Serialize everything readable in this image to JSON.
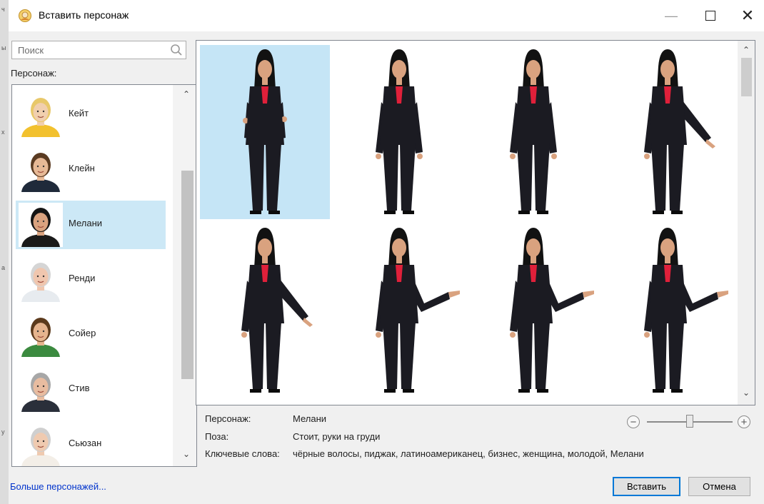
{
  "window": {
    "title": "Вставить персонаж"
  },
  "search": {
    "placeholder": "Поиск"
  },
  "sidebar": {
    "label": "Персонаж:",
    "characters": [
      {
        "name": "Кейт",
        "hair": "#e8c86a",
        "skin": "#f1cfae",
        "shirt": "#f2c12e"
      },
      {
        "name": "Клейн",
        "hair": "#5a3b22",
        "skin": "#e7b996",
        "shirt": "#1f2a3a"
      },
      {
        "name": "Мелани",
        "hair": "#141414",
        "skin": "#d9a27f",
        "shirt": "#1a1a1a",
        "selected": true
      },
      {
        "name": "Ренди",
        "hair": "#d5d5d5",
        "skin": "#f0c6ae",
        "shirt": "#e7ebef"
      },
      {
        "name": "Сойер",
        "hair": "#5c3a1c",
        "skin": "#e6b48e",
        "shirt": "#3b8a3f"
      },
      {
        "name": "Стив",
        "hair": "#a7a7a7",
        "skin": "#e8bca0",
        "shirt": "#2a2f3a"
      },
      {
        "name": "Сьюзан",
        "hair": "#cfcfcf",
        "skin": "#efcab0",
        "shirt": "#f3eee7"
      }
    ],
    "more_link": "Больше персонажей..."
  },
  "poses": [
    {
      "pose": "arms-crossed",
      "selected": true
    },
    {
      "pose": "arms-down"
    },
    {
      "pose": "arms-down"
    },
    {
      "pose": "point-down-right"
    },
    {
      "pose": "point-down-right"
    },
    {
      "pose": "point-side"
    },
    {
      "pose": "point-side"
    },
    {
      "pose": "point-side"
    }
  ],
  "details": {
    "character_label": "Персонаж:",
    "character_value": "Мелани",
    "pose_label": "Поза:",
    "pose_value": "Стоит, руки на груди",
    "keywords_label": "Ключевые слова:",
    "keywords_value": "чёрные волосы, пиджак, латиноамериканец, бизнес, женщина, молодой, Мелани"
  },
  "zoom": {
    "level": 0.5
  },
  "buttons": {
    "insert": "Вставить",
    "cancel": "Отмена"
  },
  "colors": {
    "selection": "#cce8f6",
    "accent": "#0078d7",
    "link": "#0033cc",
    "suit": "#1b1b22",
    "blouse": "#e0203a"
  },
  "icons": {
    "app": "character-icon",
    "search": "search-icon",
    "minimize": "minimize-icon",
    "maximize": "maximize-icon",
    "close": "close-icon",
    "zoom_out": "zoom-out-icon",
    "zoom_in": "zoom-in-icon"
  }
}
